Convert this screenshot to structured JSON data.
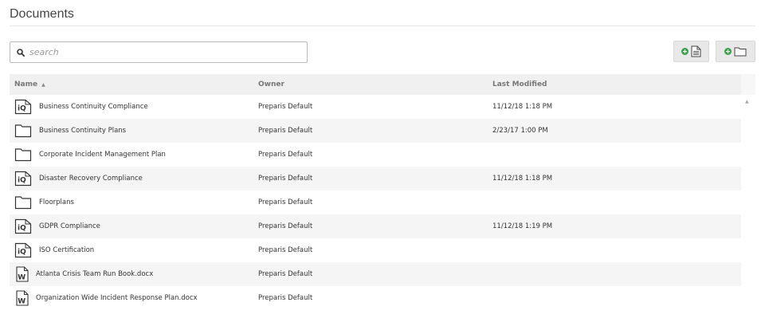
{
  "page": {
    "title": "Documents"
  },
  "search": {
    "placeholder": "search",
    "value": ""
  },
  "toolbar": {
    "add_document_icon": "add-document-icon",
    "add_folder_icon": "add-folder-icon"
  },
  "colors": {
    "accent_green": "#3aa14b",
    "header_bg": "#f0f0f0",
    "row_alt_bg": "#f5f5f5"
  },
  "table": {
    "columns": {
      "name": "Name",
      "owner": "Owner",
      "modified": "Last Modified"
    },
    "sort": {
      "column": "name",
      "direction": "asc"
    },
    "rows": [
      {
        "type": "iq",
        "icon": "iq-compliance-icon",
        "name": "Business Continuity Compliance",
        "owner": "Preparis Default",
        "modified": "11/12/18 1:18 PM"
      },
      {
        "type": "folder",
        "icon": "folder-icon",
        "name": "Business Continuity Plans",
        "owner": "Preparis Default",
        "modified": "2/23/17 1:00 PM"
      },
      {
        "type": "folder",
        "icon": "folder-icon",
        "name": "Corporate Incident Management Plan",
        "owner": "Preparis Default",
        "modified": ""
      },
      {
        "type": "iq",
        "icon": "iq-compliance-icon",
        "name": "Disaster Recovery Compliance",
        "owner": "Preparis Default",
        "modified": "11/12/18 1:18 PM"
      },
      {
        "type": "folder",
        "icon": "folder-icon",
        "name": "Floorplans",
        "owner": "Preparis Default",
        "modified": ""
      },
      {
        "type": "iq",
        "icon": "iq-compliance-icon",
        "name": "GDPR Compliance",
        "owner": "Preparis Default",
        "modified": "11/12/18 1:19 PM"
      },
      {
        "type": "iq",
        "icon": "iq-compliance-icon",
        "name": "ISO Certification",
        "owner": "Preparis Default",
        "modified": ""
      },
      {
        "type": "doc",
        "icon": "word-document-icon",
        "name": "Atlanta Crisis Team Run Book.docx",
        "owner": "Preparis Default",
        "modified": ""
      },
      {
        "type": "doc",
        "icon": "word-document-icon",
        "name": "Organization Wide Incident Response Plan.docx",
        "owner": "Preparis Default",
        "modified": ""
      }
    ]
  }
}
